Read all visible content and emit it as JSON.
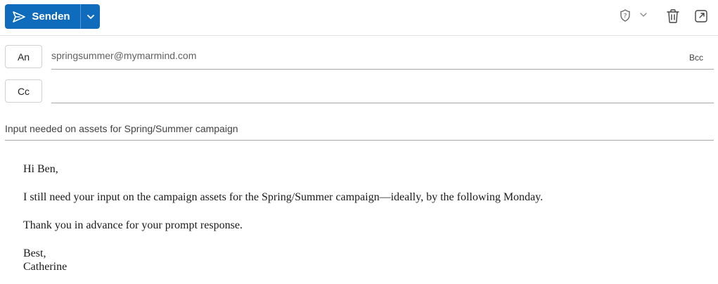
{
  "toolbar": {
    "send_label": "Senden",
    "icons": [
      "send-icon",
      "chevron-down-icon",
      "sensitivity-shield-icon",
      "chevron-down-icon",
      "trash-icon",
      "pop-out-icon"
    ]
  },
  "recipients": {
    "to_label": "An",
    "to_value": "springsummer@mymarmind.com",
    "cc_label": "Cc",
    "cc_value": "",
    "bcc_label": "Bcc"
  },
  "subject": "Input needed on assets for Spring/Summer campaign",
  "body": {
    "greeting": "Hi Ben,",
    "paragraph1": "I still need your input on the campaign assets for the Spring/Summer campaign—ideally, by the following Monday.",
    "paragraph2": "Thank you in advance for your prompt response.",
    "closing": "Best,",
    "signature": "Catherine"
  },
  "colors": {
    "accent": "#0f6cbd",
    "divider": "#a7a7a7"
  }
}
